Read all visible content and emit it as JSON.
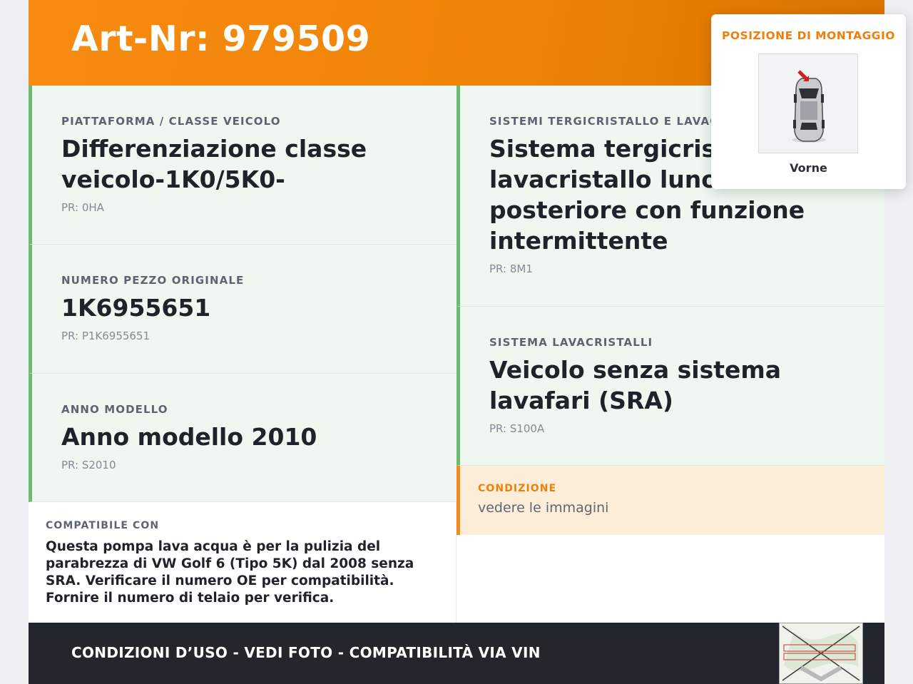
{
  "header": {
    "title": "Art-Nr: 979509"
  },
  "left_cards": [
    {
      "label": "PIATTAFORMA / CLASSE VEICOLO",
      "value": "Differenziazione classe veicolo-1K0/5K0-",
      "pr": "PR: 0HA"
    },
    {
      "label": "NUMERO PEZZO ORIGINALE",
      "value": "1K6955651",
      "pr": "PR: P1K6955651"
    },
    {
      "label": "ANNO MODELLO",
      "value": "Anno modello 2010",
      "pr": "PR: S2010"
    }
  ],
  "right_cards": [
    {
      "label": "SISTEMI TERGICRISTALLO E LAVACRISTALLO",
      "value": "Sistema tergicristallo e lavacristallo lunotto posteriore con funzione intermittente",
      "pr": "PR: 8M1"
    },
    {
      "label": "SISTEMA LAVACRISTALLI",
      "value": "Veicolo senza sistema lavafari (SRA)",
      "pr": "PR: S100A"
    }
  ],
  "condition": {
    "label": "CONDIZIONE",
    "text": "vedere le immagini"
  },
  "compat": {
    "label": "COMPATIBILE CON",
    "text": "Questa pompa lava acqua è per la pulizia del parabrezza di VW Golf 6 (Tipo 5K) dal 2008 senza SRA. Verificare il numero OE per compatibilità. Fornire il numero di telaio per verifica."
  },
  "footer": {
    "text": "CONDIZIONI D’USO - VEDI FOTO - COMPATIBILITÀ VIA VIN"
  },
  "mounting_popup": {
    "label": "POSIZIONE DI MONTAGGIO",
    "caption": "Vorne",
    "icon": "car-top-view-icon"
  },
  "colors": {
    "accent": "#f28c1a",
    "card_border": "#6dbb6f",
    "card_bg": "#f0f7f1",
    "footer_bg": "#23262c"
  }
}
